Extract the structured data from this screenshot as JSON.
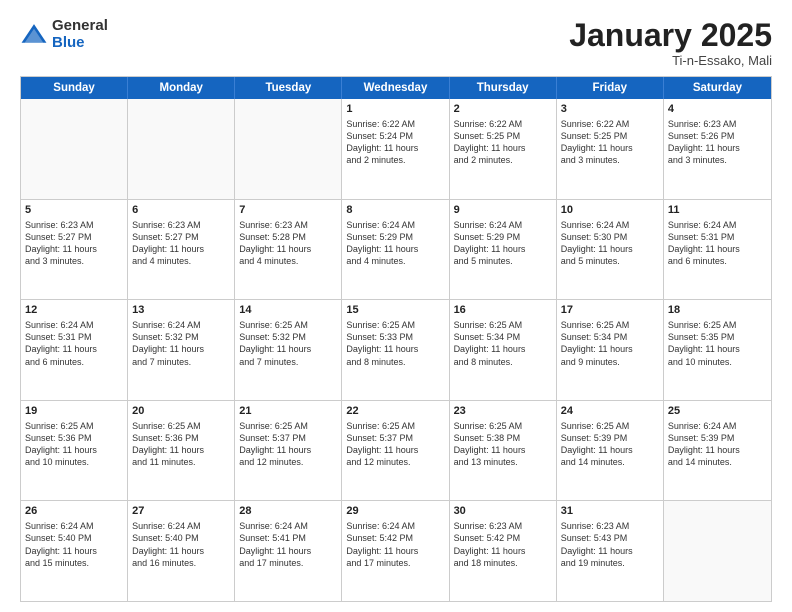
{
  "header": {
    "logo_general": "General",
    "logo_blue": "Blue",
    "month_title": "January 2025",
    "location": "Ti-n-Essako, Mali"
  },
  "days_of_week": [
    "Sunday",
    "Monday",
    "Tuesday",
    "Wednesday",
    "Thursday",
    "Friday",
    "Saturday"
  ],
  "rows": [
    {
      "cells": [
        {
          "day": "",
          "empty": true
        },
        {
          "day": "",
          "empty": true
        },
        {
          "day": "",
          "empty": true
        },
        {
          "day": "1",
          "line1": "Sunrise: 6:22 AM",
          "line2": "Sunset: 5:24 PM",
          "line3": "Daylight: 11 hours",
          "line4": "and 2 minutes."
        },
        {
          "day": "2",
          "line1": "Sunrise: 6:22 AM",
          "line2": "Sunset: 5:25 PM",
          "line3": "Daylight: 11 hours",
          "line4": "and 2 minutes."
        },
        {
          "day": "3",
          "line1": "Sunrise: 6:22 AM",
          "line2": "Sunset: 5:25 PM",
          "line3": "Daylight: 11 hours",
          "line4": "and 3 minutes."
        },
        {
          "day": "4",
          "line1": "Sunrise: 6:23 AM",
          "line2": "Sunset: 5:26 PM",
          "line3": "Daylight: 11 hours",
          "line4": "and 3 minutes."
        }
      ]
    },
    {
      "cells": [
        {
          "day": "5",
          "line1": "Sunrise: 6:23 AM",
          "line2": "Sunset: 5:27 PM",
          "line3": "Daylight: 11 hours",
          "line4": "and 3 minutes."
        },
        {
          "day": "6",
          "line1": "Sunrise: 6:23 AM",
          "line2": "Sunset: 5:27 PM",
          "line3": "Daylight: 11 hours",
          "line4": "and 4 minutes."
        },
        {
          "day": "7",
          "line1": "Sunrise: 6:23 AM",
          "line2": "Sunset: 5:28 PM",
          "line3": "Daylight: 11 hours",
          "line4": "and 4 minutes."
        },
        {
          "day": "8",
          "line1": "Sunrise: 6:24 AM",
          "line2": "Sunset: 5:29 PM",
          "line3": "Daylight: 11 hours",
          "line4": "and 4 minutes."
        },
        {
          "day": "9",
          "line1": "Sunrise: 6:24 AM",
          "line2": "Sunset: 5:29 PM",
          "line3": "Daylight: 11 hours",
          "line4": "and 5 minutes."
        },
        {
          "day": "10",
          "line1": "Sunrise: 6:24 AM",
          "line2": "Sunset: 5:30 PM",
          "line3": "Daylight: 11 hours",
          "line4": "and 5 minutes."
        },
        {
          "day": "11",
          "line1": "Sunrise: 6:24 AM",
          "line2": "Sunset: 5:31 PM",
          "line3": "Daylight: 11 hours",
          "line4": "and 6 minutes."
        }
      ]
    },
    {
      "cells": [
        {
          "day": "12",
          "line1": "Sunrise: 6:24 AM",
          "line2": "Sunset: 5:31 PM",
          "line3": "Daylight: 11 hours",
          "line4": "and 6 minutes."
        },
        {
          "day": "13",
          "line1": "Sunrise: 6:24 AM",
          "line2": "Sunset: 5:32 PM",
          "line3": "Daylight: 11 hours",
          "line4": "and 7 minutes."
        },
        {
          "day": "14",
          "line1": "Sunrise: 6:25 AM",
          "line2": "Sunset: 5:32 PM",
          "line3": "Daylight: 11 hours",
          "line4": "and 7 minutes."
        },
        {
          "day": "15",
          "line1": "Sunrise: 6:25 AM",
          "line2": "Sunset: 5:33 PM",
          "line3": "Daylight: 11 hours",
          "line4": "and 8 minutes."
        },
        {
          "day": "16",
          "line1": "Sunrise: 6:25 AM",
          "line2": "Sunset: 5:34 PM",
          "line3": "Daylight: 11 hours",
          "line4": "and 8 minutes."
        },
        {
          "day": "17",
          "line1": "Sunrise: 6:25 AM",
          "line2": "Sunset: 5:34 PM",
          "line3": "Daylight: 11 hours",
          "line4": "and 9 minutes."
        },
        {
          "day": "18",
          "line1": "Sunrise: 6:25 AM",
          "line2": "Sunset: 5:35 PM",
          "line3": "Daylight: 11 hours",
          "line4": "and 10 minutes."
        }
      ]
    },
    {
      "cells": [
        {
          "day": "19",
          "line1": "Sunrise: 6:25 AM",
          "line2": "Sunset: 5:36 PM",
          "line3": "Daylight: 11 hours",
          "line4": "and 10 minutes."
        },
        {
          "day": "20",
          "line1": "Sunrise: 6:25 AM",
          "line2": "Sunset: 5:36 PM",
          "line3": "Daylight: 11 hours",
          "line4": "and 11 minutes."
        },
        {
          "day": "21",
          "line1": "Sunrise: 6:25 AM",
          "line2": "Sunset: 5:37 PM",
          "line3": "Daylight: 11 hours",
          "line4": "and 12 minutes."
        },
        {
          "day": "22",
          "line1": "Sunrise: 6:25 AM",
          "line2": "Sunset: 5:37 PM",
          "line3": "Daylight: 11 hours",
          "line4": "and 12 minutes."
        },
        {
          "day": "23",
          "line1": "Sunrise: 6:25 AM",
          "line2": "Sunset: 5:38 PM",
          "line3": "Daylight: 11 hours",
          "line4": "and 13 minutes."
        },
        {
          "day": "24",
          "line1": "Sunrise: 6:25 AM",
          "line2": "Sunset: 5:39 PM",
          "line3": "Daylight: 11 hours",
          "line4": "and 14 minutes."
        },
        {
          "day": "25",
          "line1": "Sunrise: 6:24 AM",
          "line2": "Sunset: 5:39 PM",
          "line3": "Daylight: 11 hours",
          "line4": "and 14 minutes."
        }
      ]
    },
    {
      "cells": [
        {
          "day": "26",
          "line1": "Sunrise: 6:24 AM",
          "line2": "Sunset: 5:40 PM",
          "line3": "Daylight: 11 hours",
          "line4": "and 15 minutes."
        },
        {
          "day": "27",
          "line1": "Sunrise: 6:24 AM",
          "line2": "Sunset: 5:40 PM",
          "line3": "Daylight: 11 hours",
          "line4": "and 16 minutes."
        },
        {
          "day": "28",
          "line1": "Sunrise: 6:24 AM",
          "line2": "Sunset: 5:41 PM",
          "line3": "Daylight: 11 hours",
          "line4": "and 17 minutes."
        },
        {
          "day": "29",
          "line1": "Sunrise: 6:24 AM",
          "line2": "Sunset: 5:42 PM",
          "line3": "Daylight: 11 hours",
          "line4": "and 17 minutes."
        },
        {
          "day": "30",
          "line1": "Sunrise: 6:23 AM",
          "line2": "Sunset: 5:42 PM",
          "line3": "Daylight: 11 hours",
          "line4": "and 18 minutes."
        },
        {
          "day": "31",
          "line1": "Sunrise: 6:23 AM",
          "line2": "Sunset: 5:43 PM",
          "line3": "Daylight: 11 hours",
          "line4": "and 19 minutes."
        },
        {
          "day": "",
          "empty": true
        }
      ]
    }
  ]
}
